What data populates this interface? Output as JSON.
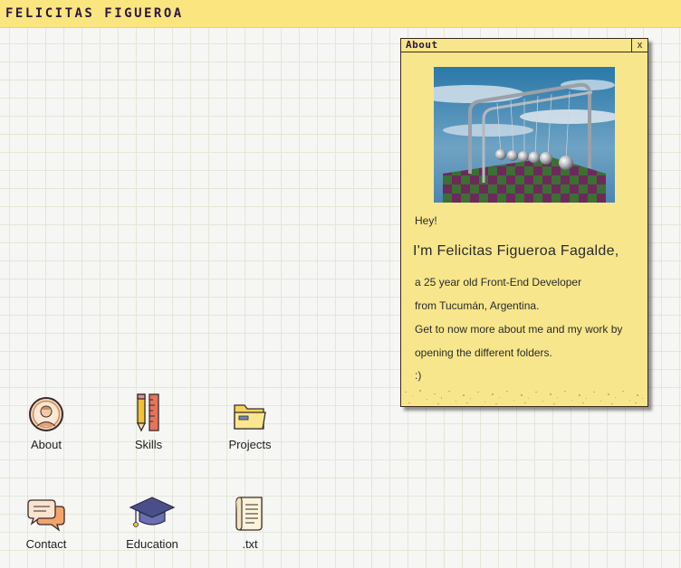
{
  "header": {
    "brand": "FELICITAS FIGUEROA"
  },
  "window": {
    "title": "About",
    "close_label": "x",
    "greeting": "Hey!",
    "headline": "I'm Felicitas Figueroa Fagalde,",
    "lines": [
      "a 25 year old Front-End Developer",
      "from Tucumán, Argentina.",
      "Get to now more about me and my work by",
      "opening the different folders.",
      ":)"
    ]
  },
  "desktop": {
    "icons": [
      {
        "label": "About",
        "icon": "user-avatar-icon"
      },
      {
        "label": "Skills",
        "icon": "pencil-ruler-icon"
      },
      {
        "label": "Projects",
        "icon": "folder-icon"
      },
      {
        "label": "Contact",
        "icon": "chat-bubbles-icon"
      },
      {
        "label": "Education",
        "icon": "graduation-cap-icon"
      },
      {
        "label": ".txt",
        "icon": "text-document-icon"
      }
    ]
  },
  "colors": {
    "accent": "#fbe57f",
    "window_bg": "#f8e68c",
    "brand_text": "#2c1740"
  }
}
